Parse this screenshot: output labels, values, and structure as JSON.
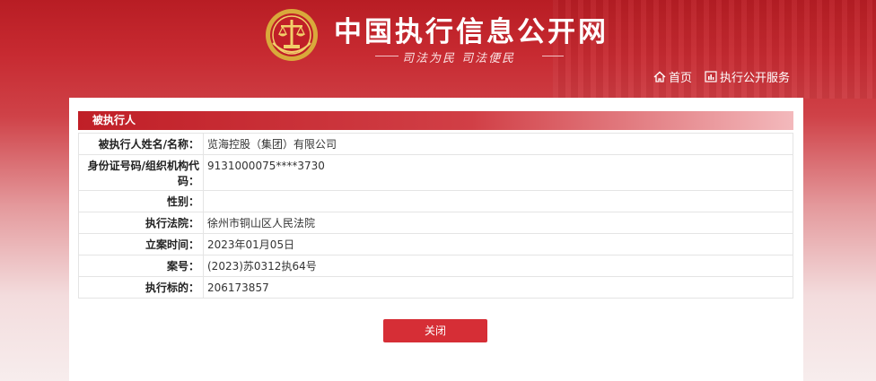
{
  "header": {
    "title": "中国执行信息公开网",
    "slogan": "司法为民  司法便民",
    "logo_icon": "court-emblem-icon",
    "nav": [
      {
        "label": "首页",
        "icon": "home-icon"
      },
      {
        "label": "执行公开服务",
        "icon": "chart-icon"
      }
    ]
  },
  "panel": {
    "section_title": "被执行人",
    "rows": [
      {
        "label": "被执行人姓名/名称：",
        "value": "览海控股（集团）有限公司"
      },
      {
        "label": "身份证号码/组织机构代码：",
        "value": "9131000075****3730"
      },
      {
        "label": "性别：",
        "value": ""
      },
      {
        "label": "执行法院：",
        "value": "徐州市铜山区人民法院"
      },
      {
        "label": "立案时间：",
        "value": "2023年01月05日"
      },
      {
        "label": "案号：",
        "value": "(2023)苏0312执64号"
      },
      {
        "label": "执行标的：",
        "value": "206173857"
      }
    ],
    "close_label": "关闭"
  },
  "colors": {
    "brand_red": "#c01f27",
    "button_red": "#d62e36"
  }
}
